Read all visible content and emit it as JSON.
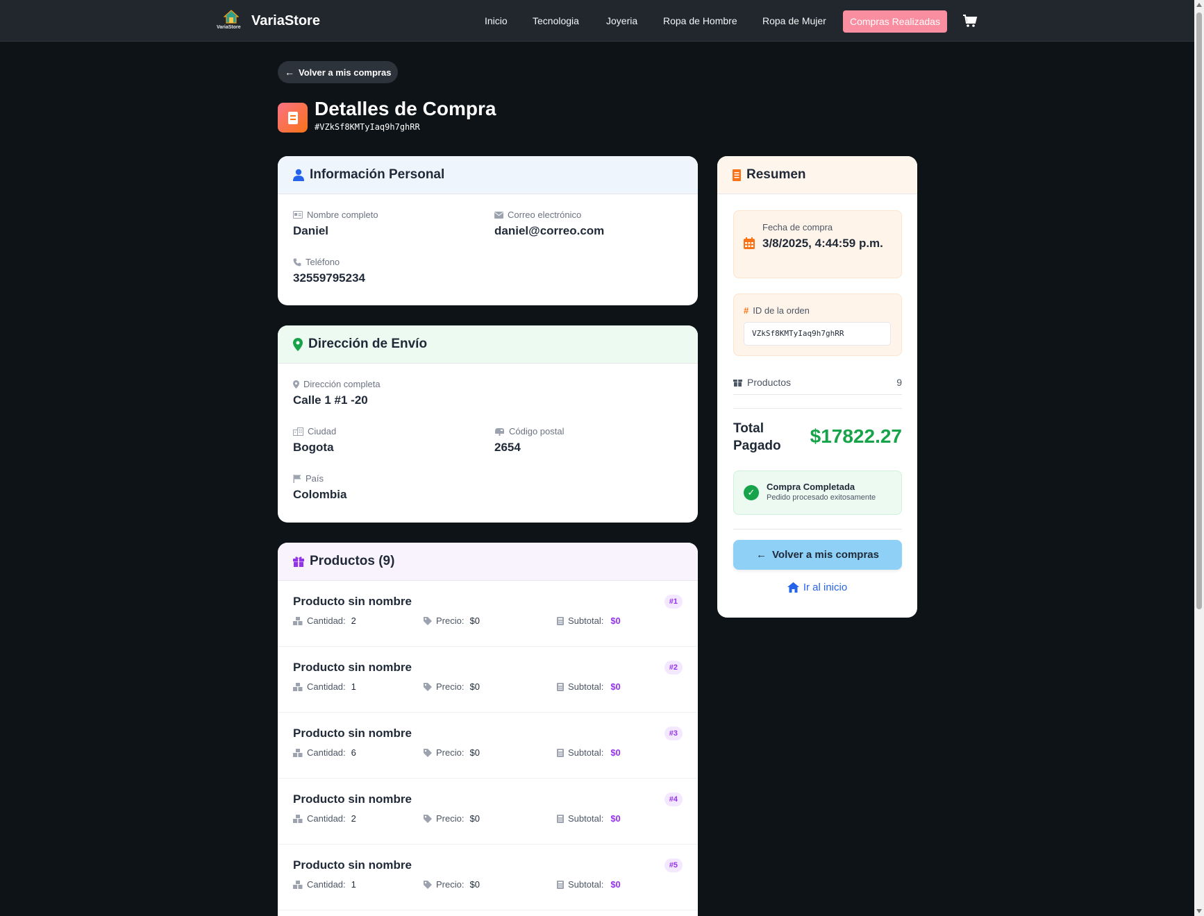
{
  "app": {
    "brand_name": "VariaStore",
    "brand_logo_caption": "VariaStore"
  },
  "nav": {
    "links": [
      "Inicio",
      "Tecnologia",
      "Joyeria",
      "Ropa de Hombre",
      "Ropa de Mujer"
    ],
    "active_link": "Compras Realizadas",
    "cart_icon": "cart-icon",
    "active_color": "#f98ea0"
  },
  "back_pill": {
    "label": "Volver a mis compras"
  },
  "header": {
    "title": "Detalles de Compra",
    "order_id": "#VZkSf8KMTyIaq9h7ghRR"
  },
  "personal": {
    "title": "Información Personal",
    "name_label": "Nombre completo",
    "name_value": "Daniel",
    "email_label": "Correo electrónico",
    "email_value": "daniel@correo.com",
    "phone_label": "Teléfono",
    "phone_value": "32559795234"
  },
  "shipping": {
    "title": "Dirección de Envío",
    "address_label": "Dirección completa",
    "address_value": "Calle 1 #1 -20",
    "city_label": "Ciudad",
    "city_value": "Bogota",
    "postal_label": "Código postal",
    "postal_value": "2654",
    "country_label": "País",
    "country_value": "Colombia"
  },
  "products": {
    "title": "Productos (9)",
    "qty_label": "Cantidad:",
    "price_label": "Precio:",
    "subtotal_label": "Subtotal:",
    "items": [
      {
        "name": "Producto sin nombre",
        "badge": "#1",
        "qty": "2",
        "price": "$0",
        "subtotal": "$0"
      },
      {
        "name": "Producto sin nombre",
        "badge": "#2",
        "qty": "1",
        "price": "$0",
        "subtotal": "$0"
      },
      {
        "name": "Producto sin nombre",
        "badge": "#3",
        "qty": "6",
        "price": "$0",
        "subtotal": "$0"
      },
      {
        "name": "Producto sin nombre",
        "badge": "#4",
        "qty": "2",
        "price": "$0",
        "subtotal": "$0"
      },
      {
        "name": "Producto sin nombre",
        "badge": "#5",
        "qty": "1",
        "price": "$0",
        "subtotal": "$0"
      }
    ]
  },
  "summary": {
    "title": "Resumen",
    "date_label": "Fecha de compra",
    "date_value": "3/8/2025, 4:44:59 p.m.",
    "order_label": "ID de la orden",
    "order_value": "VZkSf8KMTyIaq9h7ghRR",
    "products_label": "Productos",
    "products_count": "9",
    "total_label": "Total Pagado",
    "total_value": "$17822.27",
    "status_title": "Compra Completada",
    "status_sub": "Pedido procesado exitosamente",
    "back_button": "Volver a mis compras",
    "home_link": "Ir al inicio",
    "total_color": "#16a34a"
  }
}
